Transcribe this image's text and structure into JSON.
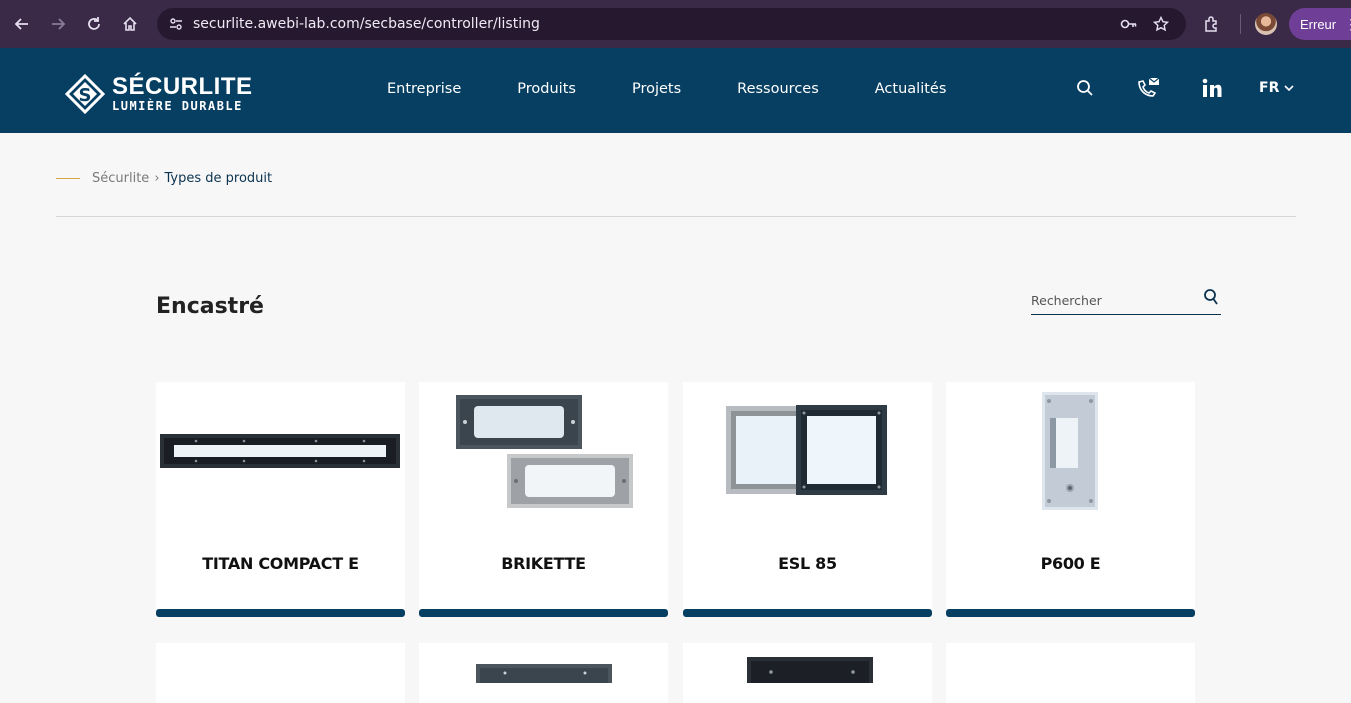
{
  "browser": {
    "url": "securlite.awebi-lab.com/secbase/controller/listing",
    "error_label": "Erreur"
  },
  "header": {
    "brand": "SÉCURLITE",
    "tagline": "LUMIÈRE DURABLE",
    "nav": [
      "Entreprise",
      "Produits",
      "Projets",
      "Ressources",
      "Actualités"
    ],
    "lang": "FR"
  },
  "breadcrumb": {
    "home": "Sécurlite",
    "current": "Types de produit"
  },
  "page": {
    "title": "Encastré",
    "search_placeholder": "Rechercher"
  },
  "products": [
    {
      "name": "TITAN COMPACT E"
    },
    {
      "name": "BRIKETTE"
    },
    {
      "name": "ESL 85"
    },
    {
      "name": "P600 E"
    }
  ],
  "colors": {
    "header_bg": "#073f63",
    "chrome_bg": "#3a2a47",
    "accent_line": "#d9a441"
  }
}
